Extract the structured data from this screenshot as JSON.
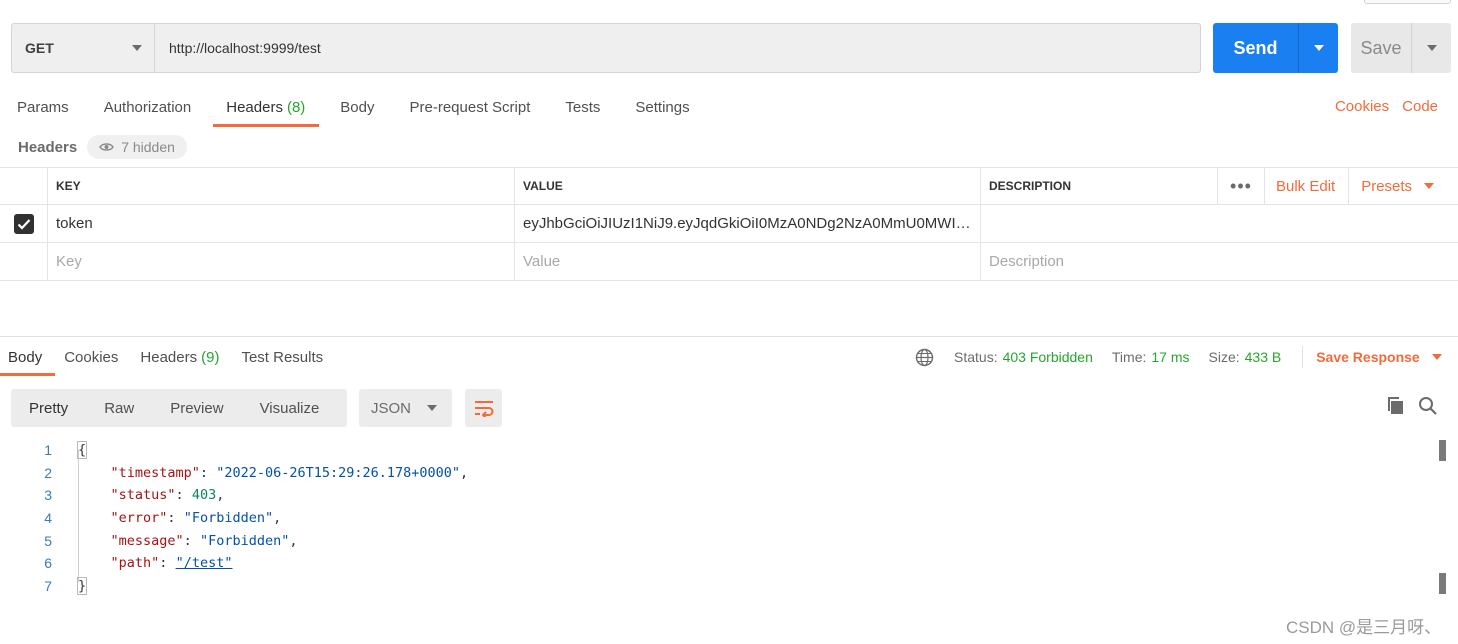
{
  "request": {
    "method": "GET",
    "url": "http://localhost:9999/test",
    "send_label": "Send",
    "save_label": "Save"
  },
  "request_tabs": [
    {
      "label": "Params",
      "count": ""
    },
    {
      "label": "Authorization",
      "count": ""
    },
    {
      "label": "Headers",
      "count": "(8)"
    },
    {
      "label": "Body",
      "count": ""
    },
    {
      "label": "Pre-request Script",
      "count": ""
    },
    {
      "label": "Tests",
      "count": ""
    },
    {
      "label": "Settings",
      "count": ""
    }
  ],
  "right_links": {
    "cookies": "Cookies",
    "code": "Code"
  },
  "headers_section": {
    "title": "Headers",
    "hidden": "7 hidden"
  },
  "headers_table": {
    "columns": {
      "key": "KEY",
      "value": "VALUE",
      "description": "DESCRIPTION"
    },
    "bulk_edit": "Bulk Edit",
    "presets": "Presets",
    "rows": [
      {
        "checked": true,
        "key": "token",
        "value": "eyJhbGciOiJIUzI1NiJ9.eyJqdGkiOiI0MzA0NDg2NzA0MmU0MWIw...",
        "description": ""
      }
    ],
    "placeholder": {
      "key": "Key",
      "value": "Value",
      "description": "Description"
    }
  },
  "response_tabs": [
    {
      "label": "Body",
      "count": ""
    },
    {
      "label": "Cookies",
      "count": ""
    },
    {
      "label": "Headers",
      "count": "(9)"
    },
    {
      "label": "Test Results",
      "count": ""
    }
  ],
  "response_status": {
    "status_label": "Status:",
    "status_value": "403 Forbidden",
    "time_label": "Time:",
    "time_value": "17 ms",
    "size_label": "Size:",
    "size_value": "433 B",
    "save_response": "Save Response"
  },
  "format_tabs": [
    "Pretty",
    "Raw",
    "Preview",
    "Visualize"
  ],
  "format_select": "JSON",
  "response_body": {
    "line_numbers": [
      "1",
      "2",
      "3",
      "4",
      "5",
      "6",
      "7"
    ],
    "open": "{",
    "close": "}",
    "fields": [
      {
        "key": "\"timestamp\"",
        "value": "\"2022-06-26T15:29:26.178+0000\"",
        "type": "s"
      },
      {
        "key": "\"status\"",
        "value": "403",
        "type": "n"
      },
      {
        "key": "\"error\"",
        "value": "\"Forbidden\"",
        "type": "s"
      },
      {
        "key": "\"message\"",
        "value": "\"Forbidden\"",
        "type": "s"
      },
      {
        "key": "\"path\"",
        "value": "\"/test\"",
        "type": "u"
      }
    ]
  },
  "watermark": "CSDN @是三月呀、",
  "colors": {
    "accent": "#f26b3a",
    "send_blue": "#1a7ff0",
    "success_green": "#26a52d"
  }
}
